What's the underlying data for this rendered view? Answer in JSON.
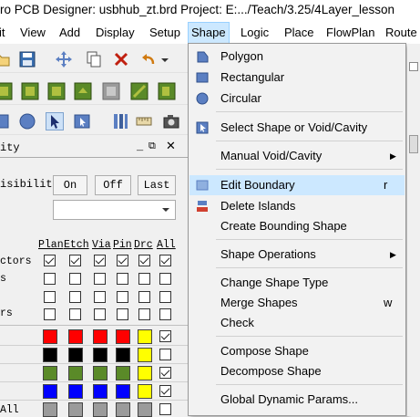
{
  "window": {
    "title": "ro PCB Designer: usbhub_zt.brd  Project: E:.../Teach/3.25/4Layer_lesson"
  },
  "menubar": {
    "items": [
      "it",
      "View",
      "Add",
      "Display",
      "Setup",
      "Shape",
      "Logic",
      "Place",
      "FlowPlan",
      "Route"
    ],
    "active": "Shape"
  },
  "panel": {
    "title": "ity",
    "visibility_label": "isibility",
    "buttons": {
      "on": "On",
      "off": "Off",
      "last": "Last"
    },
    "columns": [
      "Plan",
      "Etch",
      "Via",
      "Pin",
      "Drc",
      "All"
    ],
    "row_labels": [
      "ctors",
      "s",
      "",
      "rs",
      "",
      "",
      "",
      "",
      "All"
    ],
    "colors": {
      "red": "#ff0000",
      "black": "#000000",
      "green": "#5a8a28",
      "blue": "#0000ff",
      "yellow": "#ffff00",
      "gray": "#9b9b9b"
    }
  },
  "shape_menu": {
    "items": [
      {
        "label": "Polygon",
        "icon": "polygon-icon"
      },
      {
        "label": "Rectangular",
        "icon": "rectangle-icon"
      },
      {
        "label": "Circular",
        "icon": "circle-icon"
      },
      {
        "label": "Select Shape or Void/Cavity",
        "icon": "select-shape-icon"
      },
      {
        "label": "Manual Void/Cavity",
        "submenu": true
      },
      {
        "label": "Edit Boundary",
        "shortcut": "r",
        "icon": "edit-boundary-icon",
        "highlighted": true
      },
      {
        "label": "Delete Islands",
        "icon": "delete-islands-icon"
      },
      {
        "label": "Create Bounding Shape"
      },
      {
        "label": "Shape Operations",
        "submenu": true
      },
      {
        "label": "Change Shape Type"
      },
      {
        "label": "Merge Shapes",
        "shortcut": "w"
      },
      {
        "label": "Check"
      },
      {
        "label": "Compose Shape"
      },
      {
        "label": "Decompose Shape"
      },
      {
        "label": "Global Dynamic Params..."
      }
    ]
  }
}
